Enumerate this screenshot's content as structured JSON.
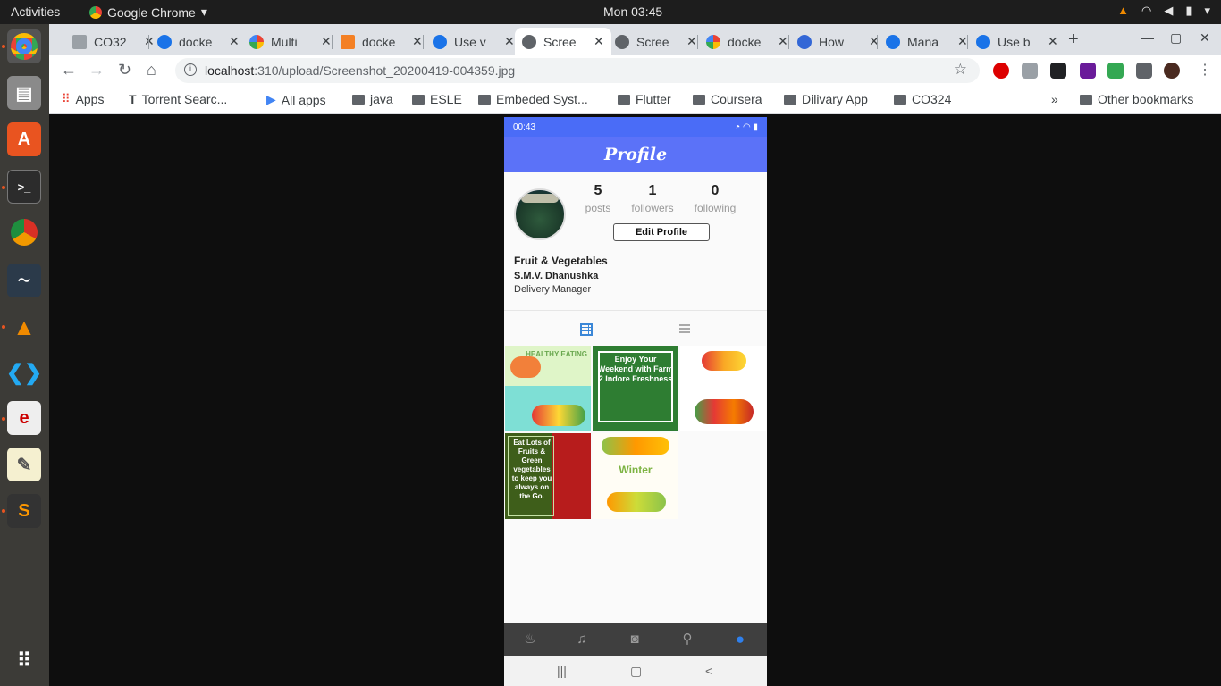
{
  "system_bar": {
    "activities": "Activities",
    "app_name": "Google Chrome",
    "clock": "Mon 03:45"
  },
  "dock": {
    "items": [
      "chrome",
      "files",
      "software-center",
      "terminal",
      "chromium",
      "system-monitor",
      "vlc",
      "vscode",
      "evince",
      "text-editor",
      "sublime-text",
      "apps-grid"
    ]
  },
  "tabs": [
    {
      "label": "CO32",
      "color": "#8ab4f8"
    },
    {
      "label": "docke",
      "color": "#1a73e8"
    },
    {
      "label": "Multi",
      "color": "#4285f4"
    },
    {
      "label": "docke",
      "color": "#f48024"
    },
    {
      "label": "Use v",
      "color": "#1a73e8"
    },
    {
      "label": "Scree",
      "color": "#5f6368",
      "active": true
    },
    {
      "label": "Scree",
      "color": "#5f6368"
    },
    {
      "label": "docke",
      "color": "#4285f4"
    },
    {
      "label": "How",
      "color": "#3367d6"
    },
    {
      "label": "Mana",
      "color": "#1a73e8"
    },
    {
      "label": "Use b",
      "color": "#1a73e8"
    }
  ],
  "toolbar": {
    "url_host": "localhost",
    "url_path": ":310/upload/Screenshot_20200419-004359.jpg"
  },
  "bookmarks": [
    {
      "label": "Apps",
      "kind": "apps"
    },
    {
      "label": "Torrent Searc...",
      "kind": "site"
    },
    {
      "label": "All apps",
      "kind": "site"
    },
    {
      "label": "java",
      "kind": "folder"
    },
    {
      "label": "ESLE",
      "kind": "folder"
    },
    {
      "label": "Embeded Syst...",
      "kind": "folder"
    },
    {
      "label": "Flutter",
      "kind": "folder"
    },
    {
      "label": "Coursera",
      "kind": "folder"
    },
    {
      "label": "Dilivary App",
      "kind": "folder"
    },
    {
      "label": "CO324",
      "kind": "folder"
    }
  ],
  "bookmarks_more": "»",
  "other_bookmarks": "Other bookmarks",
  "phone": {
    "status_time": "00:43",
    "appbar_title": "Profile",
    "stats": [
      {
        "value": "5",
        "label": "posts"
      },
      {
        "value": "1",
        "label": "followers"
      },
      {
        "value": "0",
        "label": "following"
      }
    ],
    "edit_profile": "Edit Profile",
    "name": "Fruit & Vegetables",
    "person": "S.M.V. Dhanushka",
    "role": "Delivery Manager",
    "posts": [
      {
        "caption": "HEALTHY EATING"
      },
      {
        "caption": "Enjoy Your Weekend with Farm 2 Indore Freshness"
      },
      {
        "caption": ""
      },
      {
        "caption": "Eat Lots of Fruits & Green vegetables to keep you always on the Go."
      },
      {
        "caption": "Winter"
      }
    ]
  }
}
